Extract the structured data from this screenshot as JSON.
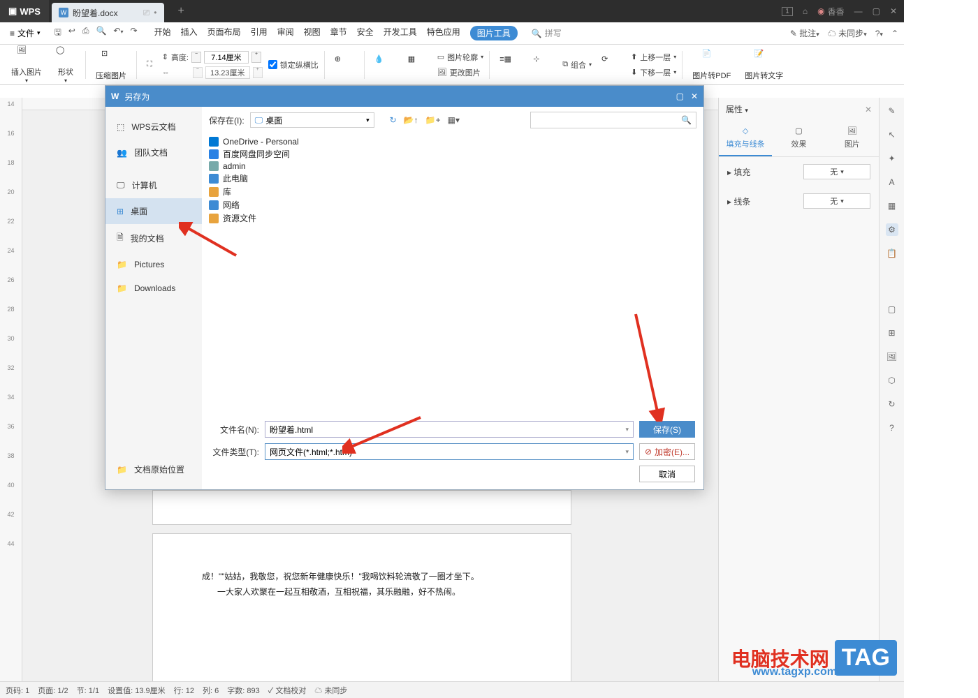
{
  "titlebar": {
    "logo": "WPS",
    "tab_name": "盼望着.docx",
    "user": "香香"
  },
  "menu": {
    "file": "文件",
    "items": [
      "开始",
      "插入",
      "页面布局",
      "引用",
      "审阅",
      "视图",
      "章节",
      "安全",
      "开发工具",
      "特色应用",
      "图片工具"
    ],
    "active": "图片工具",
    "search": "拼写",
    "annotate": "批注",
    "sync": "未同步"
  },
  "ribbon": {
    "insert_pic": "插入图片",
    "shape": "形状",
    "compress": "压缩图片",
    "height_label": "高度:",
    "height_value": "7.14厘米",
    "width_value": "13.23厘米",
    "lock_ratio": "锁定纵横比",
    "outline": "图片轮廓",
    "change": "更改图片",
    "combine": "组合",
    "up_layer": "上移一层",
    "down_layer": "下移一层",
    "to_pdf": "图片转PDF",
    "to_text": "图片转文字"
  },
  "side": {
    "title": "属性",
    "tab_fill": "填充与线条",
    "tab_effect": "效果",
    "tab_img": "图片",
    "fill": "填充",
    "line": "线条",
    "none": "无"
  },
  "dialog": {
    "title": "另存为",
    "nav": [
      "WPS云文档",
      "团队文档",
      "计算机",
      "桌面",
      "我的文档",
      "Pictures",
      "Downloads"
    ],
    "nav_bottom": "文档原始位置",
    "savein": "保存在(I):",
    "loc": "桌面",
    "files": [
      "OneDrive - Personal",
      "百度网盘同步空间",
      "admin",
      "此电脑",
      "库",
      "网络",
      "资源文件"
    ],
    "fname_label": "文件名(N):",
    "fname": "盼望着.html",
    "ftype_label": "文件类型(T):",
    "ftype": "网页文件(*.html;*.htm)",
    "save": "保存(S)",
    "encrypt": "加密(E)...",
    "cancel": "取消"
  },
  "doc_text": {
    "l1": "成！\"\"姑姑，我敬您，祝您新年健康快乐！\"我喝饮料轮流敬了一圈才坐下。",
    "l2": "一大家人欢聚在一起互相敬酒，互相祝福，其乐融融，好不热闹。"
  },
  "status": {
    "page_label": "页码:",
    "page": "1",
    "pages_label": "页面:",
    "pages": "1/2",
    "section_label": "节:",
    "section": "1/1",
    "set_label": "设置值:",
    "set": "13.9厘米",
    "row_label": "行:",
    "row": "12",
    "col_label": "列:",
    "col": "6",
    "words_label": "字数:",
    "words": "893",
    "proof": "文档校对",
    "unsynced": "未同步"
  },
  "watermark": {
    "brand": "电脑技术网",
    "url": "www.tagxp.com",
    "tag": "TAG"
  }
}
